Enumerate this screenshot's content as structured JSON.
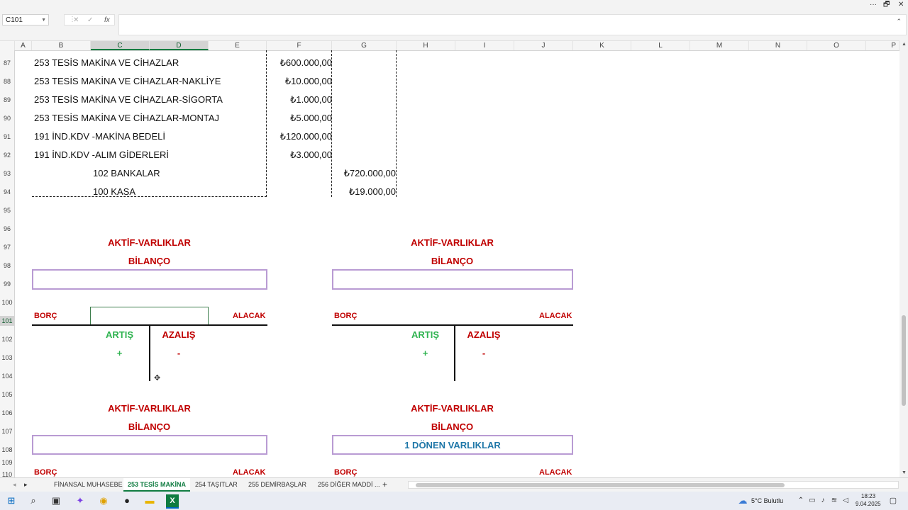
{
  "window": {
    "min": "···",
    "restore": "🗗",
    "close": "✕"
  },
  "formula_bar": {
    "name_box": "C101",
    "cancel": "✕",
    "enter": "✓",
    "fx": "fx",
    "value": ""
  },
  "columns": [
    "A",
    "B",
    "C",
    "D",
    "E",
    "F",
    "G",
    "H",
    "I",
    "J",
    "K",
    "L",
    "M",
    "N",
    "O",
    "P"
  ],
  "rows": [
    "87",
    "88",
    "89",
    "90",
    "91",
    "92",
    "93",
    "94",
    "95",
    "96",
    "97",
    "98",
    "99",
    "100",
    "101",
    "102",
    "103",
    "104",
    "105",
    "106",
    "107",
    "108",
    "109",
    "110"
  ],
  "entries": [
    {
      "label": "253 TESİS MAKİNA VE CİHAZLAR",
      "debit": "₺600.000,00"
    },
    {
      "label": "253 TESİS MAKİNA VE CİHAZLAR-NAKLİYE",
      "debit": "₺10.000,00"
    },
    {
      "label": "253 TESİS MAKİNA VE CİHAZLAR-SİGORTA",
      "debit": "₺1.000,00"
    },
    {
      "label": "253 TESİS MAKİNA VE CİHAZLAR-MONTAJ",
      "debit": "₺5.000,00"
    },
    {
      "label": "191 İND.KDV -MAKİNA BEDELİ",
      "debit": "₺120.000,00"
    },
    {
      "label": "191 İND.KDV -ALIM GİDERLERİ",
      "debit": "₺3.000,00"
    }
  ],
  "credits": [
    {
      "label": "102 BANKALAR",
      "credit": "₺720.000,00"
    },
    {
      "label": "100 KASA",
      "credit": "₺19.000,00"
    }
  ],
  "t_accounts": {
    "top_left": {
      "heading": "AKTİF-VARLIKLAR",
      "sub": "BİLANÇO",
      "box": "",
      "borc": "BORÇ",
      "alacak": "ALACAK",
      "artis": "ARTIŞ",
      "azalis": "AZALIŞ",
      "plus": "+",
      "minus": "-"
    },
    "top_right": {
      "heading": "AKTİF-VARLIKLAR",
      "sub": "BİLANÇO",
      "box": "",
      "borc": "BORÇ",
      "alacak": "ALACAK",
      "artis": "ARTIŞ",
      "azalis": "AZALIŞ",
      "plus": "+",
      "minus": "-"
    },
    "bottom_left": {
      "heading": "AKTİF-VARLIKLAR",
      "sub": "BİLANÇO",
      "box": "",
      "borc": "BORÇ",
      "alacak": "ALACAK"
    },
    "bottom_right": {
      "heading": "AKTİF-VARLIKLAR",
      "sub": "BİLANÇO",
      "box": "1 DÖNEN VARLIKLAR",
      "borc": "BORÇ",
      "alacak": "ALACAK"
    }
  },
  "sheet_tabs": [
    "FİNANSAL MUHASEBE",
    "253 TESİS MAKİNA",
    "254 TAŞITLAR",
    "255 DEMİRBAŞLAR",
    "256 DİĞER MADDİ ..."
  ],
  "active_tab": "253 TESİS MAKİNA",
  "tab_nav": "▸",
  "add_sheet": "+",
  "taskbar": {
    "weather": "5°C  Bulutlu",
    "time": "18:23",
    "date": "9.04.2025"
  },
  "colors": {
    "accent": "#107c41",
    "heading": "#c00000",
    "artis": "#2fb350",
    "box_border": "#b99bd3",
    "box_text": "#1f77a8"
  }
}
